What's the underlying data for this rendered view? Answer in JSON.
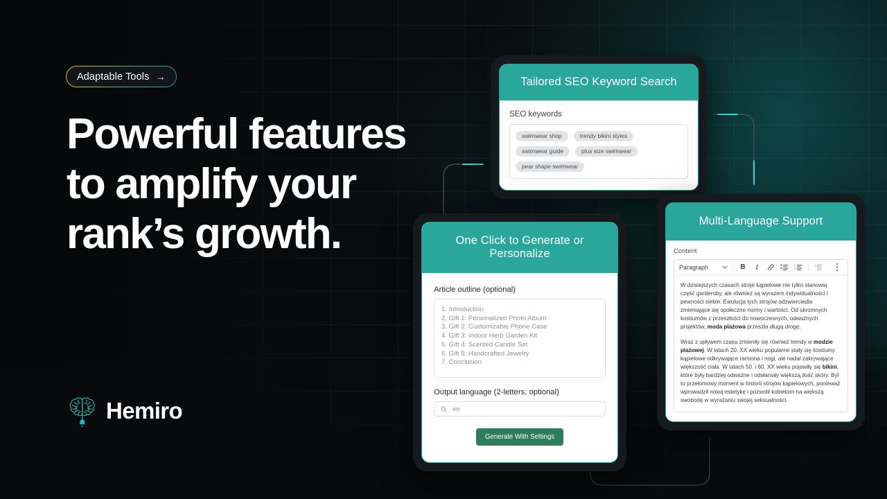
{
  "hero": {
    "badge_label": "Adaptable Tools",
    "badge_arrow": "→",
    "headline_line1": "Powerful features",
    "headline_line2": "to amplify your",
    "headline_line3": "rank’s growth.",
    "brand_name": "Hemiro",
    "brand_icon": "brain-pen-icon"
  },
  "colors": {
    "accent_teal": "#2aa79b",
    "button_green": "#2e7d5b",
    "badge_gradient_start": "#d9b63a",
    "badge_gradient_end": "#1d9aa0",
    "background": "#0a0d0f"
  },
  "seo_card": {
    "title": "Tailored SEO Keyword Search",
    "field_label": "SEO keywords",
    "keywords": [
      "swimwear shop",
      "trendy bikini styles",
      "swimwear guide",
      "plus size swimwear",
      "pear shape swimwear"
    ]
  },
  "generate_card": {
    "title": "One Click to Generate or Personalize",
    "outline_label": "Article outline (optional)",
    "outline_lines": [
      "1. Introduction",
      "2. Gift 1: Personalized Photo Album",
      "3. Gift 2: Customizable Phone Case",
      "4. Gift 3: Indoor Herb Garden Kit",
      "5. Gift 4: Scented Candle Set",
      "6. Gift 5: Handcrafted Jewelry",
      "7. Conclusion"
    ],
    "language_label": "Output language (2-letters; optional)",
    "language_value": "en",
    "language_icon": "search-icon",
    "button_label": "Generate With Settings"
  },
  "language_card": {
    "title": "Multi-Language Support",
    "content_label": "Content",
    "toolbar": {
      "style_select": "Paragraph",
      "chevron_icon": "chevron-down-icon",
      "bold_label": "B",
      "italic_label": "I",
      "link_icon": "link-icon",
      "bullet_list_icon": "bullet-list-icon",
      "numbered_list_icon": "numbered-list-icon",
      "indent_icon": "indent-icon",
      "more_icon": "kebab-menu-icon"
    },
    "paragraph_1": {
      "part_a": "W dzisiejszych czasach stroje kąpielowe nie tylko stanowią część garderoby, ale również są wyrazem indywidualności i pewności siebie. Ewolucja tych strojów odzwierciedla zmieniające się społeczne normy i wartości. Od skromnych kostiumów z przeszłości do nowoczesnych, odważnych projektów, ",
      "bold_1": "moda plażowa",
      "part_b": " przeszła długą drogę."
    },
    "paragraph_2": {
      "part_a": "Wraz z upływem czasu zmieniły się również trendy w ",
      "bold_1": "modzie plażowej",
      "part_b": ". W latach 20. XX wieku popularne stały się kostiumy kąpielowe odkrywające ramiona i nogi, ale nadal zakrywające większość ciała. W latach 50. i 60. XX wieku pojawiły się ",
      "bold_2": "bikini",
      "part_c": ", które były bardziej odważne i odsłaniały większą ilość skóry. Był to przełomowy moment w historii strojów kąpielowych, ponieważ wprowadził nową estetykę i pozwolił kobietom na większą swobodę w wyrażaniu swojej seksualności."
    }
  }
}
